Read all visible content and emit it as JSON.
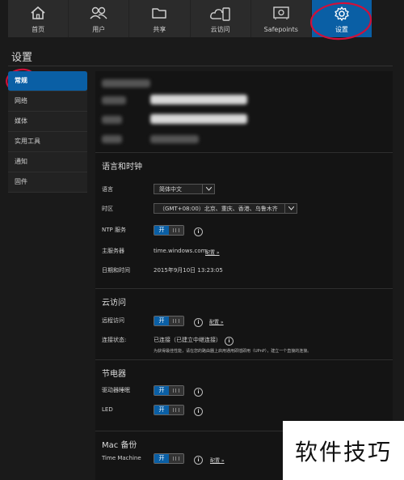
{
  "nav": {
    "items": [
      {
        "label": "首页",
        "icon": "home-icon"
      },
      {
        "label": "用户",
        "icon": "users-icon"
      },
      {
        "label": "共享",
        "icon": "folder-icon"
      },
      {
        "label": "云访问",
        "icon": "cloud-device-icon"
      },
      {
        "label": "Safepoints",
        "icon": "safe-icon"
      },
      {
        "label": "设置",
        "icon": "gear-icon",
        "active": true
      }
    ]
  },
  "page": {
    "title": "设置"
  },
  "sidebar": {
    "items": [
      {
        "label": "常规",
        "active": true
      },
      {
        "label": "网络"
      },
      {
        "label": "媒体"
      },
      {
        "label": "实用工具"
      },
      {
        "label": "通知"
      },
      {
        "label": "固件"
      }
    ]
  },
  "language_time": {
    "title": "语言和时钟",
    "language_label": "语言",
    "language_value": "简体中文",
    "timezone_label": "时区",
    "timezone_value": "（GMT+08:00）北京、重庆、香港、乌鲁木齐",
    "ntp_label": "NTP 服务",
    "ntp_toggle": "开",
    "server_label": "主服务器",
    "server_value": "time.windows.com",
    "server_link": "配置 »",
    "datetime_label": "日期和时间",
    "datetime_value": "2015年9月10日 13:23:05"
  },
  "cloud": {
    "title": "云访问",
    "remote_label": "远程访问",
    "remote_toggle": "开",
    "remote_link": "配置 »",
    "status_label": "连接状态:",
    "status_value": "已连接（已建立中继连接）",
    "status_note": "为获得最佳性能，请在您的路由器上启用通用即插即用（UPnP），建立一个直接的连接。"
  },
  "energy": {
    "title": "节电器",
    "sleep_label": "驱动器睡眠",
    "sleep_toggle": "开",
    "led_label": "LED",
    "led_toggle": "开"
  },
  "mac": {
    "title": "Mac 备份",
    "tm_label": "Time Machine",
    "tm_toggle": "开",
    "tm_link": "配置 »"
  },
  "watermark": "软件技巧",
  "colors": {
    "accent": "#0a5fa5",
    "background": "#1a1a1a",
    "annotation": "#d0103a"
  }
}
